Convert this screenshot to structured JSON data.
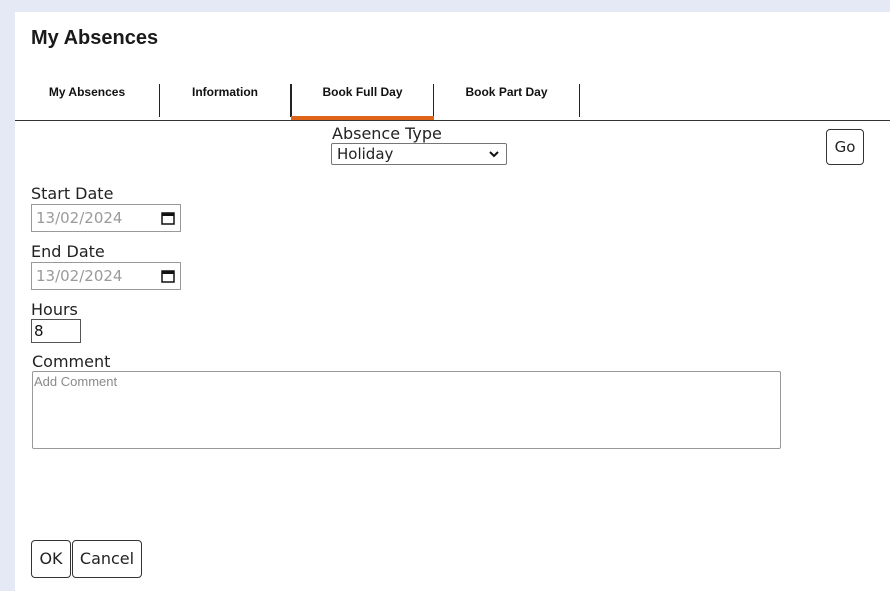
{
  "page": {
    "title": "My Absences"
  },
  "tabs": [
    {
      "label": "My Absences",
      "active": false
    },
    {
      "label": "Information",
      "active": false
    },
    {
      "label": "Book Full Day",
      "active": true
    },
    {
      "label": "Book Part Day",
      "active": false
    }
  ],
  "accent_color": "#e0631a",
  "form": {
    "absence_type": {
      "label": "Absence Type",
      "value": "Holiday"
    },
    "go_label": "Go",
    "start_date": {
      "label": "Start Date",
      "value": "13/02/2024"
    },
    "end_date": {
      "label": "End Date",
      "value": "13/02/2024"
    },
    "hours": {
      "label": "Hours",
      "value": "8"
    },
    "comment": {
      "label": "Comment",
      "placeholder": "Add Comment"
    }
  },
  "actions": {
    "ok_label": "OK",
    "cancel_label": "Cancel"
  },
  "icons": {
    "select": "chevron-down-icon",
    "date": "calendar-icon"
  }
}
